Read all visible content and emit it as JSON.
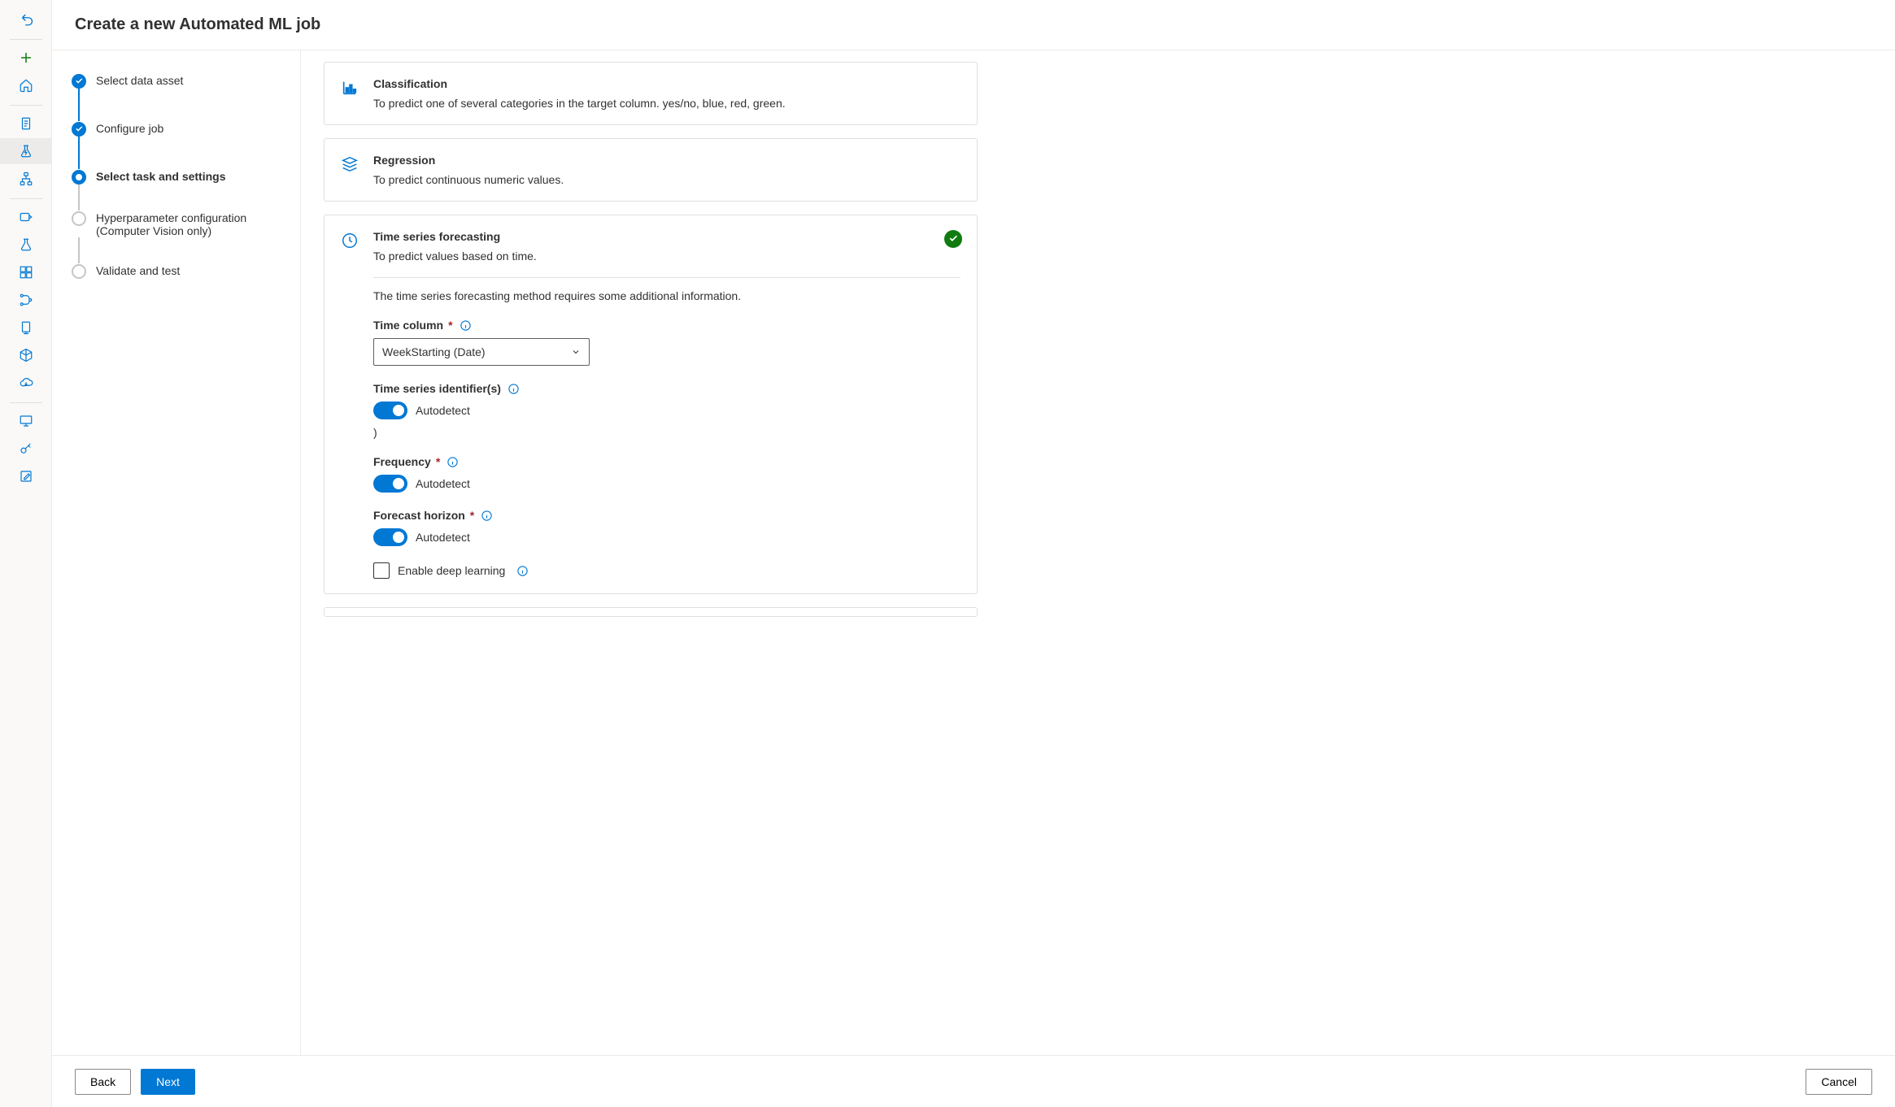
{
  "header": {
    "title": "Create a new Automated ML job"
  },
  "steps": [
    {
      "label": "Select data asset",
      "state": "done"
    },
    {
      "label": "Configure job",
      "state": "done"
    },
    {
      "label": "Select task and settings",
      "state": "current"
    },
    {
      "label": "Hyperparameter configuration (Computer Vision only)",
      "state": "pending"
    },
    {
      "label": "Validate and test",
      "state": "pending"
    }
  ],
  "tasks": {
    "classification": {
      "title": "Classification",
      "desc": "To predict one of several categories in the target column. yes/no, blue, red, green."
    },
    "regression": {
      "title": "Regression",
      "desc": "To predict continuous numeric values."
    },
    "forecasting": {
      "title": "Time series forecasting",
      "desc": "To predict values based on time.",
      "info": "The time series forecasting method requires some additional information.",
      "selected": true
    }
  },
  "form": {
    "time_column_label": "Time column",
    "time_column_value": "WeekStarting (Date)",
    "ts_id_label": "Time series identifier(s)",
    "ts_id_toggle": "Autodetect",
    "stray": ")",
    "freq_label": "Frequency",
    "freq_toggle": "Autodetect",
    "horizon_label": "Forecast horizon",
    "horizon_toggle": "Autodetect",
    "deep_learning_label": "Enable deep learning"
  },
  "footer": {
    "back": "Back",
    "next": "Next",
    "cancel": "Cancel"
  }
}
